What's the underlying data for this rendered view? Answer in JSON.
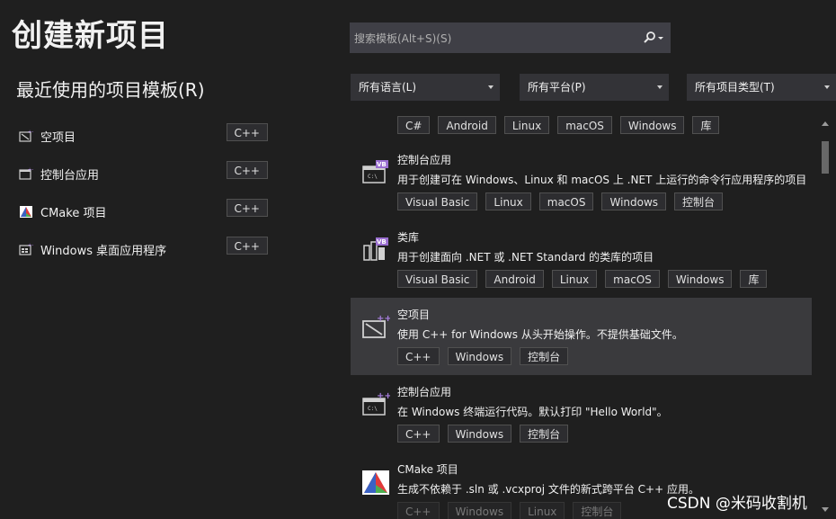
{
  "page": {
    "title": "创建新项目"
  },
  "recent": {
    "heading": "最近使用的项目模板(R)",
    "items": [
      {
        "label": "空项目",
        "tag": "C++",
        "icon": "empty-project-icon"
      },
      {
        "label": "控制台应用",
        "tag": "C++",
        "icon": "console-app-icon"
      },
      {
        "label": "CMake 项目",
        "tag": "C++",
        "icon": "cmake-icon"
      },
      {
        "label": "Windows 桌面应用程序",
        "tag": "C++",
        "icon": "windows-desktop-icon"
      }
    ]
  },
  "search": {
    "placeholder": "搜索模板(Alt+S)(S)",
    "icon": "search-icon"
  },
  "filters": {
    "language": "所有语言(L)",
    "platform": "所有平台(P)",
    "type": "所有项目类型(T)"
  },
  "template_list": {
    "top_tags": [
      "C#",
      "Android",
      "Linux",
      "macOS",
      "Windows",
      "库"
    ],
    "items": [
      {
        "name": "控制台应用",
        "description": "用于创建可在 Windows、Linux 和 macOS 上 .NET 上运行的命令行应用程序的项目",
        "tags": [
          "Visual Basic",
          "Linux",
          "macOS",
          "Windows",
          "控制台"
        ],
        "icon": "vb-console-icon",
        "selected": false
      },
      {
        "name": "类库",
        "description": "用于创建面向 .NET 或 .NET Standard 的类库的项目",
        "tags": [
          "Visual Basic",
          "Android",
          "Linux",
          "macOS",
          "Windows",
          "库"
        ],
        "icon": "vb-class-library-icon",
        "selected": false
      },
      {
        "name": "空项目",
        "description": "使用 C++ for Windows 从头开始操作。不提供基础文件。",
        "tags": [
          "C++",
          "Windows",
          "控制台"
        ],
        "icon": "cpp-empty-project-icon",
        "selected": true
      },
      {
        "name": "控制台应用",
        "description": "在 Windows 终端运行代码。默认打印 \"Hello World\"。",
        "tags": [
          "C++",
          "Windows",
          "控制台"
        ],
        "icon": "cpp-console-icon",
        "selected": false
      },
      {
        "name": "CMake 项目",
        "description": "生成不依赖于 .sln 或 .vcxproj 文件的新式跨平台 C++ 应用。",
        "tags": [
          "C++",
          "Windows",
          "Linux",
          "控制台"
        ],
        "icon": "cmake-project-icon",
        "selected": false
      }
    ]
  },
  "watermark": "CSDN @米码收割机",
  "colors": {
    "background": "#1f1f1f",
    "selected_row": "#3a3a3d",
    "vb_purple": "#9b6fd1",
    "cpp_purple": "#a87fe0",
    "search_bg": "#3f3f46"
  }
}
